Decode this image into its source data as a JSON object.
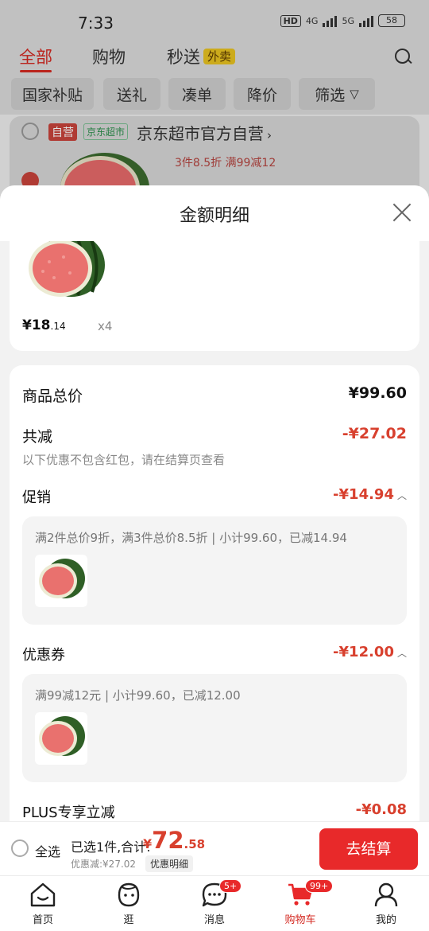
{
  "status_bar": {
    "time": "7:33",
    "hd": "HD",
    "net1": "4G",
    "net2": "5G",
    "battery": "58"
  },
  "top_tabs": {
    "all": "全部",
    "shopping": "购物",
    "flash": "秒送",
    "takeaway_badge": "外卖"
  },
  "filter_chips": [
    "国家补贴",
    "送礼",
    "凑单",
    "降价",
    "筛选"
  ],
  "store": {
    "self_tag": "自营",
    "jd_tag": "京东超市",
    "name": "京东超市官方自营",
    "promo": "3件8.5折  满99减12"
  },
  "sheet": {
    "title": "金额明细",
    "item": {
      "price_int": "¥18",
      "price_dec": ".14",
      "qty": "x4"
    },
    "total_label": "商品总价",
    "total_value": "¥99.60",
    "reduce_label": "共减",
    "reduce_value": "-¥27.02",
    "reduce_hint": "以下优惠不包含红包，请在结算页查看",
    "promo_label": "促销",
    "promo_value": "-¥14.94",
    "promo_detail": "满2件总价9折，满3件总价8.5折 | 小计99.60，已减14.94",
    "coupon_label": "优惠券",
    "coupon_value": "-¥12.00",
    "coupon_detail": "满99减12元 | 小计99.60，已减12.00",
    "plus_label": "PLUS专享立减",
    "plus_value": "-¥0.08"
  },
  "checkout": {
    "select_all": "全选",
    "selected": "已选1件,合计:",
    "currency": "¥",
    "total_int": "72",
    "total_dec": ".58",
    "discount": "优惠减:¥27.02",
    "detail_btn": "优惠明细",
    "pay": "去结算"
  },
  "nav": {
    "home": "首页",
    "browse": "逛",
    "messages": "消息",
    "messages_badge": "5+",
    "cart": "购物车",
    "cart_badge": "99+",
    "me": "我的"
  },
  "colors": {
    "accent": "#e8292a",
    "price_red": "#d8402e"
  }
}
